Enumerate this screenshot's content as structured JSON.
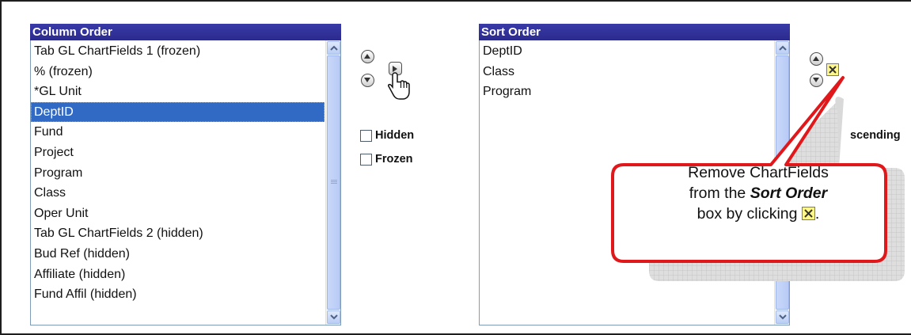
{
  "column_order": {
    "header": "Column Order",
    "items": [
      "Tab GL ChartFields 1 (frozen)",
      "% (frozen)",
      "*GL Unit",
      "DeptID",
      "Fund",
      "Project",
      "Program",
      "Class",
      "Oper Unit",
      "Tab GL ChartFields 2 (hidden)",
      "Bud Ref (hidden)",
      "Affiliate (hidden)",
      "Fund Affil (hidden)"
    ],
    "selected": "DeptID"
  },
  "options": {
    "hidden_label": "Hidden",
    "frozen_label": "Frozen"
  },
  "sort_order": {
    "header": "Sort Order",
    "items": [
      "DeptID",
      "Class",
      "Program"
    ],
    "ascending_label": "scending"
  },
  "callout": {
    "line1": "Remove ChartFields",
    "line2_pre": "from the ",
    "line2_emphasis": "Sort Order",
    "line3_pre": "box by clicking ",
    "line3_post": "."
  },
  "icons": {
    "move_up": "arrow-up-circle",
    "move_down": "arrow-down-circle",
    "add_to_sort": "arrow-right",
    "remove": "x-box",
    "cursor": "hand-pointer"
  },
  "colors": {
    "header_bg": "#2a2a8e",
    "selection": "#316ac5",
    "callout_border": "#e0181b",
    "remove_button": "#fff78a"
  }
}
